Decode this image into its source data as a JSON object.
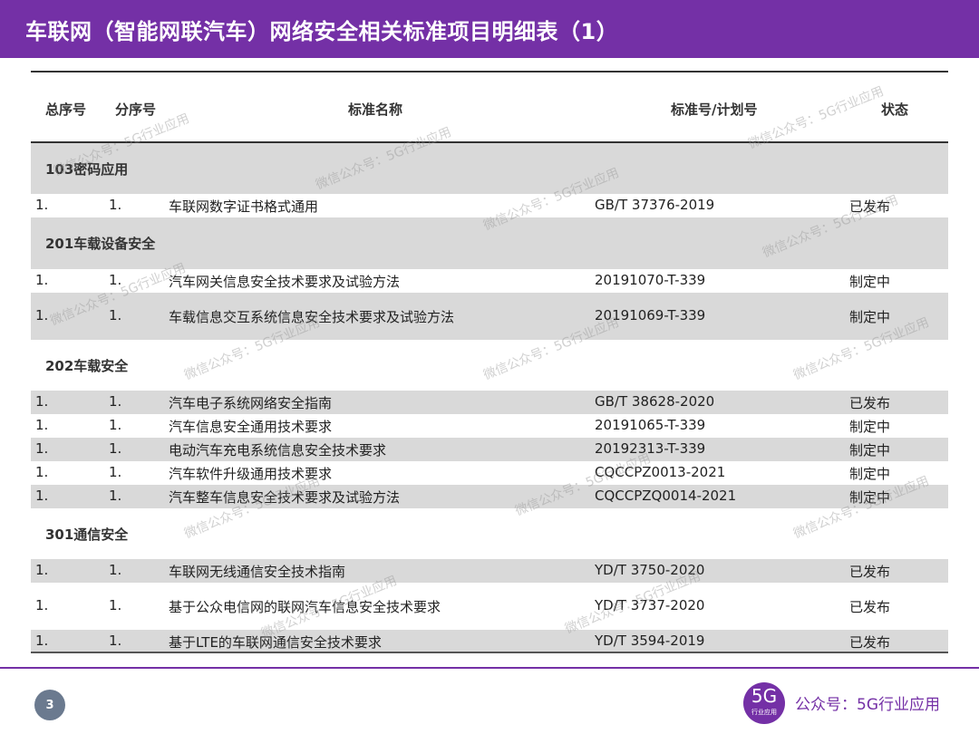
{
  "title": "车联网（智能网联汽车）网络安全相关标准项目明细表（1）",
  "headers": {
    "no": "总序号",
    "sub": "分序号",
    "name": "标准名称",
    "std": "标准号/计划号",
    "status": "状态"
  },
  "sections": [
    {
      "label": "103密码应用",
      "rows": [
        {
          "no": "1.",
          "sub": "1.",
          "name": "车联网数字证书格式通用",
          "std": "GB/T 37376-2019",
          "status": "已发布"
        }
      ]
    },
    {
      "label": "201车载设备安全",
      "rows": [
        {
          "no": "1.",
          "sub": "1.",
          "name": "汽车网关信息安全技术要求及试验方法",
          "std": "20191070-T-339",
          "status": "制定中"
        },
        {
          "no": "1.",
          "sub": "1.",
          "name": "车载信息交互系统信息安全技术要求及试验方法",
          "std": "20191069-T-339",
          "status": "制定中"
        }
      ]
    },
    {
      "label": "202车载安全",
      "rows": [
        {
          "no": "1.",
          "sub": "1.",
          "name": "汽车电子系统网络安全指南",
          "std": "GB/T 38628-2020",
          "status": "已发布"
        },
        {
          "no": "1.",
          "sub": "1.",
          "name": "汽车信息安全通用技术要求",
          "std": "20191065-T-339",
          "status": "制定中"
        },
        {
          "no": "1.",
          "sub": "1.",
          "name": "电动汽车充电系统信息安全技术要求",
          "std": "20192313-T-339",
          "status": "制定中"
        },
        {
          "no": "1.",
          "sub": "1.",
          "name": "汽车软件升级通用技术要求",
          "std": "CQCCPZ0013-2021",
          "status": "制定中"
        },
        {
          "no": "1.",
          "sub": "1.",
          "name": "汽车整车信息安全技术要求及试验方法",
          "std": "CQCCPZQ0014-2021",
          "status": "制定中"
        }
      ]
    },
    {
      "label": "301通信安全",
      "rows": [
        {
          "no": "1.",
          "sub": "1.",
          "name": "车联网无线通信安全技术指南",
          "std": "YD/T 3750-2020",
          "status": "已发布"
        },
        {
          "no": "1.",
          "sub": "1.",
          "name": "基于公众电信网的联网汽车信息安全技术要求",
          "std": "YD/T 3737-2020",
          "status": "已发布"
        },
        {
          "no": "1.",
          "sub": "1.",
          "name": "基于LTE的车联网通信安全技术要求",
          "std": "YD/T 3594-2019",
          "status": "已发布"
        }
      ]
    }
  ],
  "footer": {
    "page": "3",
    "logo_main": "5G",
    "logo_sub": "行业应用",
    "account": "公众号：5G行业应用"
  },
  "watermark": "微信公众号：5G行业应用",
  "colors": {
    "accent": "#7430a6",
    "row_gray": "#d9d9d9"
  }
}
